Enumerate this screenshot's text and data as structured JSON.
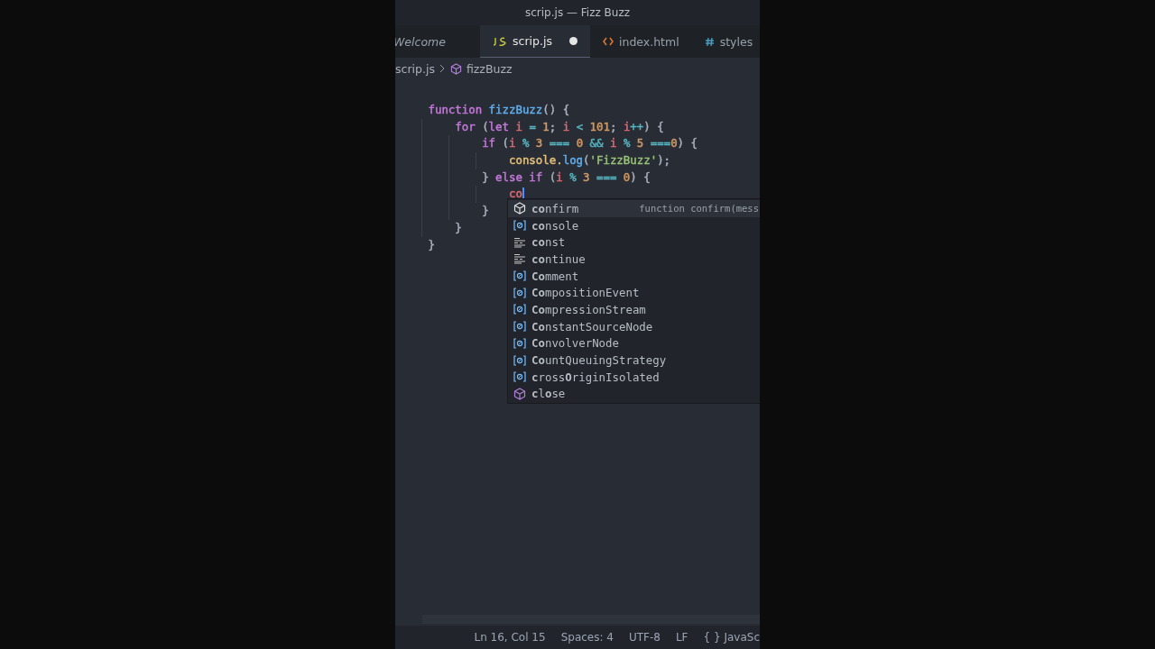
{
  "window": {
    "title": "scrip.js — Fizz Buzz"
  },
  "tabs": [
    {
      "label": "Welcome",
      "kind": "preview",
      "selected": false,
      "dirty": false
    },
    {
      "label": "scrip.js",
      "kind": "js",
      "selected": true,
      "dirty": true
    },
    {
      "label": "index.html",
      "kind": "html",
      "selected": false,
      "dirty": false
    },
    {
      "label": "styles",
      "kind": "css",
      "selected": false,
      "dirty": false
    }
  ],
  "breadcrumb": [
    {
      "label": "scrip.js",
      "kind": "file"
    },
    {
      "label": "fizzBuzz",
      "kind": "function"
    }
  ],
  "code": [
    {
      "tokens": [
        {
          "t": "function ",
          "color": "#c678dd"
        },
        {
          "t": "fizzBuzz",
          "color": "#61afef"
        },
        {
          "t": "() {",
          "color": "#abb2bf"
        }
      ],
      "children": [
        {
          "tokens": [
            {
              "t": "for ",
              "color": "#c678dd"
            },
            {
              "t": "(",
              "color": "#abb2bf"
            },
            {
              "t": "let ",
              "color": "#c678dd"
            },
            {
              "t": "i",
              "color": "#e06c75"
            },
            {
              "t": " = ",
              "color": "#56b6c2"
            },
            {
              "t": "1",
              "color": "#d19a66"
            },
            {
              "t": "; ",
              "color": "#abb2bf"
            },
            {
              "t": "i",
              "color": "#e06c75"
            },
            {
              "t": " < ",
              "color": "#56b6c2"
            },
            {
              "t": "101",
              "color": "#d19a66"
            },
            {
              "t": "; ",
              "color": "#abb2bf"
            },
            {
              "t": "i",
              "color": "#e06c75"
            },
            {
              "t": "++",
              "color": "#56b6c2"
            },
            {
              "t": ") {",
              "color": "#abb2bf"
            }
          ],
          "children": [
            {
              "tokens": [
                {
                  "t": "if ",
                  "color": "#c678dd"
                },
                {
                  "t": "(",
                  "color": "#abb2bf"
                },
                {
                  "t": "i",
                  "color": "#e06c75"
                },
                {
                  "t": " % ",
                  "color": "#56b6c2"
                },
                {
                  "t": "3",
                  "color": "#d19a66"
                },
                {
                  "t": " === ",
                  "color": "#56b6c2"
                },
                {
                  "t": "0",
                  "color": "#d19a66"
                },
                {
                  "t": " && ",
                  "color": "#56b6c2"
                },
                {
                  "t": "i",
                  "color": "#e06c75"
                },
                {
                  "t": " % ",
                  "color": "#56b6c2"
                },
                {
                  "t": "5",
                  "color": "#d19a66"
                },
                {
                  "t": " ===",
                  "color": "#56b6c2"
                },
                {
                  "t": "0",
                  "color": "#d19a66"
                },
                {
                  "t": ") {",
                  "color": "#abb2bf"
                }
              ],
              "children": [
                {
                  "tokens": [
                    {
                      "t": "console.",
                      "color": "#e5c07b"
                    },
                    {
                      "t": "log",
                      "color": "#61afef"
                    },
                    {
                      "t": "(",
                      "color": "#abb2bf"
                    },
                    {
                      "t": "'FizzBuzz'",
                      "color": "#98c379"
                    },
                    {
                      "t": ");",
                      "color": "#abb2bf"
                    }
                  ]
                }
              ]
            },
            {
              "tokens": [
                {
                  "t": "} ",
                  "color": "#abb2bf"
                },
                {
                  "t": "else if ",
                  "color": "#c678dd"
                },
                {
                  "t": "(",
                  "color": "#abb2bf"
                },
                {
                  "t": "i",
                  "color": "#e06c75"
                },
                {
                  "t": " % ",
                  "color": "#56b6c2"
                },
                {
                  "t": "3",
                  "color": "#d19a66"
                },
                {
                  "t": " === ",
                  "color": "#56b6c2"
                },
                {
                  "t": "0",
                  "color": "#d19a66"
                },
                {
                  "t": ") {",
                  "color": "#abb2bf"
                }
              ],
              "children": [
                {
                  "tokens": [
                    {
                      "t": "co",
                      "color": "#e06c75"
                    }
                  ],
                  "cursor": true
                }
              ]
            },
            {
              "tokens": [
                {
                  "t": "}",
                  "color": "#abb2bf"
                }
              ]
            }
          ]
        },
        {
          "tokens": [
            {
              "t": "}",
              "color": "#abb2bf"
            }
          ]
        }
      ]
    },
    {
      "tokens": [
        {
          "t": "}",
          "color": "#abb2bf"
        }
      ]
    }
  ],
  "suggestions": [
    {
      "label": "**co**nfirm",
      "kind": "method",
      "selected": true,
      "detail": "function confirm(mess"
    },
    {
      "label": "**co**nsole",
      "kind": "variable",
      "selected": false
    },
    {
      "label": "**co**nst",
      "kind": "keyword",
      "selected": false
    },
    {
      "label": "**co**ntinue",
      "kind": "keyword",
      "selected": false
    },
    {
      "label": "**Co**mment",
      "kind": "variable",
      "selected": false
    },
    {
      "label": "**Co**mpositionEvent",
      "kind": "variable",
      "selected": false
    },
    {
      "label": "**Co**mpressionStream",
      "kind": "variable",
      "selected": false
    },
    {
      "label": "**Co**nstantSourceNode",
      "kind": "variable",
      "selected": false
    },
    {
      "label": "**Co**nvolverNode",
      "kind": "variable",
      "selected": false
    },
    {
      "label": "**Co**untQueuingStrategy",
      "kind": "variable",
      "selected": false
    },
    {
      "label": "**c**ross**O**riginIsolated",
      "kind": "variable",
      "selected": false
    },
    {
      "label": "**c**l**o**se",
      "kind": "method",
      "selected": false
    }
  ],
  "status_bar": [
    "Ln 16, Col 15",
    "Spaces: 4",
    "UTF-8",
    "LF",
    "{ } JavaSc"
  ]
}
